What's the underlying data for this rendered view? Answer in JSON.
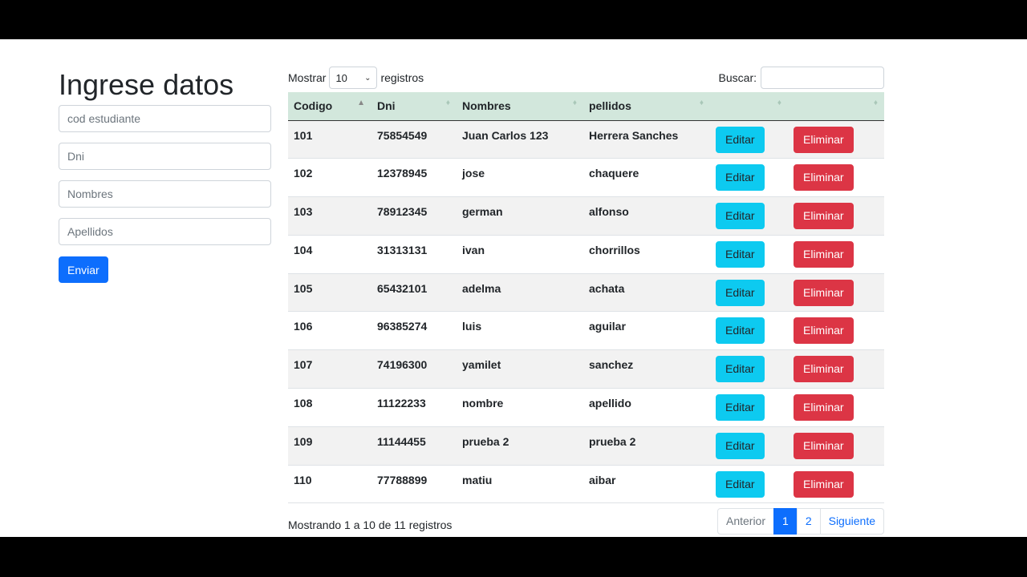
{
  "form": {
    "title": "Ingrese datos",
    "fields": [
      {
        "placeholder": "cod estudiante",
        "value": ""
      },
      {
        "placeholder": "Dni",
        "value": ""
      },
      {
        "placeholder": "Nombres",
        "value": ""
      },
      {
        "placeholder": "Apellidos",
        "value": ""
      }
    ],
    "submit_label": "Enviar"
  },
  "table": {
    "length_prefix": "Mostrar",
    "length_value": "10",
    "length_suffix": "registros",
    "search_label": "Buscar:",
    "search_value": "",
    "columns": [
      "Codigo",
      "Dni",
      "Nombres",
      "pellidos",
      "",
      ""
    ],
    "sorted_column": "Codigo",
    "rows": [
      {
        "codigo": "101",
        "dni": "75854549",
        "nombres": "Juan Carlos 123",
        "apellidos": "Herrera Sanches"
      },
      {
        "codigo": "102",
        "dni": "12378945",
        "nombres": "jose",
        "apellidos": "chaquere"
      },
      {
        "codigo": "103",
        "dni": "78912345",
        "nombres": "german",
        "apellidos": "alfonso"
      },
      {
        "codigo": "104",
        "dni": "31313131",
        "nombres": "ivan",
        "apellidos": "chorrillos"
      },
      {
        "codigo": "105",
        "dni": "65432101",
        "nombres": "adelma",
        "apellidos": "achata"
      },
      {
        "codigo": "106",
        "dni": "96385274",
        "nombres": "luis",
        "apellidos": "aguilar"
      },
      {
        "codigo": "107",
        "dni": "74196300",
        "nombres": "yamilet",
        "apellidos": "sanchez"
      },
      {
        "codigo": "108",
        "dni": "11122233",
        "nombres": "nombre",
        "apellidos": "apellido"
      },
      {
        "codigo": "109",
        "dni": "11144455",
        "nombres": "prueba 2",
        "apellidos": "prueba 2"
      },
      {
        "codigo": "110",
        "dni": "77788899",
        "nombres": "matiu",
        "apellidos": "aibar"
      }
    ],
    "edit_label": "Editar",
    "delete_label": "Eliminar",
    "info": "Mostrando 1 a 10 de 11 registros",
    "pagination": {
      "prev": "Anterior",
      "pages": [
        "1",
        "2"
      ],
      "active": "1",
      "next": "Siguiente"
    }
  },
  "colors": {
    "primary": "#0d6efd",
    "info": "#0dcaf0",
    "danger": "#dc3545",
    "header_bg": "#d2e7dc"
  },
  "icons": [
    "sort-asc-icon",
    "sort-both-icon",
    "chevron-down-icon"
  ]
}
